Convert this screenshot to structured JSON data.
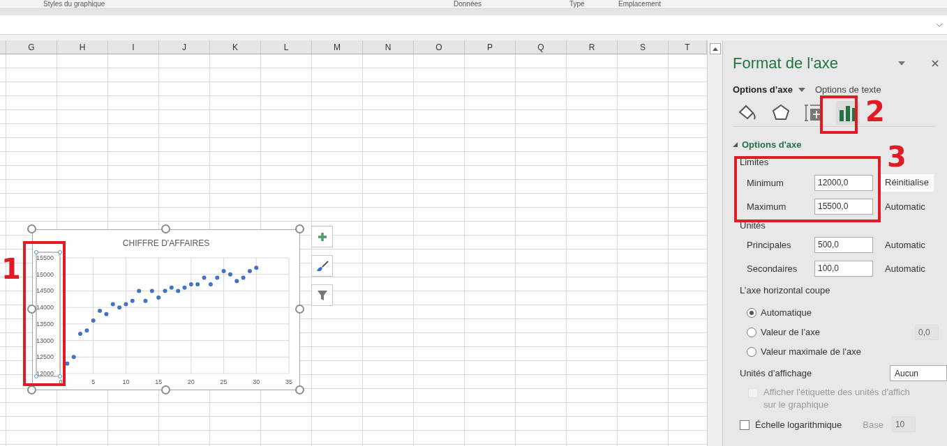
{
  "ribbon_groups": [
    "Styles du graphique",
    "Données",
    "Type",
    "Emplacement"
  ],
  "columns": [
    "G",
    "H",
    "I",
    "J",
    "K",
    "L",
    "M",
    "N",
    "O",
    "P",
    "Q",
    "R",
    "S",
    "T"
  ],
  "chart": {
    "chart_data": {
      "type": "scatter",
      "title": "CHIFFRE D'AFFAIRES",
      "grid": true,
      "xlim": [
        0,
        35
      ],
      "ylim": [
        12000,
        15500
      ],
      "xticks": [
        0,
        5,
        10,
        15,
        20,
        25,
        30,
        35
      ],
      "yticks": [
        12000,
        12500,
        13000,
        13500,
        14000,
        14500,
        15000,
        15500
      ],
      "x": [
        1,
        2,
        3,
        4,
        5,
        6,
        7,
        8,
        9,
        10,
        11,
        12,
        13,
        14,
        15,
        16,
        17,
        18,
        19,
        20,
        21,
        22,
        23,
        24,
        25,
        26,
        27,
        28,
        29,
        30
      ],
      "series": [
        {
          "color": "#4472c4",
          "values": [
            12300,
            12500,
            13200,
            13300,
            13600,
            13900,
            13800,
            14100,
            14000,
            14100,
            14200,
            14500,
            14200,
            14500,
            14300,
            14500,
            14600,
            14500,
            14600,
            14700,
            14700,
            14900,
            14700,
            14900,
            15100,
            15000,
            14800,
            14900,
            15100,
            15200
          ]
        }
      ]
    }
  },
  "annotations": [
    {
      "label": "1"
    },
    {
      "label": "2"
    },
    {
      "label": "3"
    }
  ],
  "pane": {
    "title": "Format de l'axe",
    "tabs": [
      {
        "label": "Options d’axe",
        "selected": true
      },
      {
        "label": "Options de texte",
        "selected": false
      }
    ],
    "icon_tabs": [
      {
        "kind": "bucket",
        "selected": false
      },
      {
        "kind": "pentagon",
        "selected": false
      },
      {
        "kind": "size",
        "selected": false
      },
      {
        "kind": "bars",
        "selected": true
      }
    ],
    "section": {
      "label": "Options d'axe",
      "expanded": true
    },
    "limits_label": "Limites",
    "limits": [
      {
        "label": "Minimum",
        "value": "12000,0",
        "action": "Réinitialise",
        "kind": "button"
      },
      {
        "label": "Maximum",
        "value": "15500,0",
        "action": "Automatic",
        "kind": "text"
      }
    ],
    "units_label": "Unités",
    "units": [
      {
        "label": "Principales",
        "value": "500,0",
        "action": "Automatic",
        "kind": "text"
      },
      {
        "label": "Secondaires",
        "value": "100,0",
        "action": "Automatic",
        "kind": "text"
      }
    ],
    "crosses_label": "L’axe horizontal coupe",
    "crosses": [
      {
        "label": "Automatique",
        "selected": true
      },
      {
        "label": "Valeur de l’axe",
        "selected": false,
        "value": "0,0"
      },
      {
        "label": "Valeur maximale de l'axe",
        "selected": false
      }
    ],
    "display_units": {
      "label": "Unités d’affichage",
      "value": "Aucun"
    },
    "show_label": {
      "lines": [
        "Afficher l'étiquette des unités d'affich",
        "sur le graphique"
      ],
      "checked": false,
      "disabled": true
    },
    "log_scale": {
      "label": "Échelle logarithmique",
      "checked": false,
      "base_label": "Base",
      "base_value": "10",
      "disabled": true
    }
  }
}
